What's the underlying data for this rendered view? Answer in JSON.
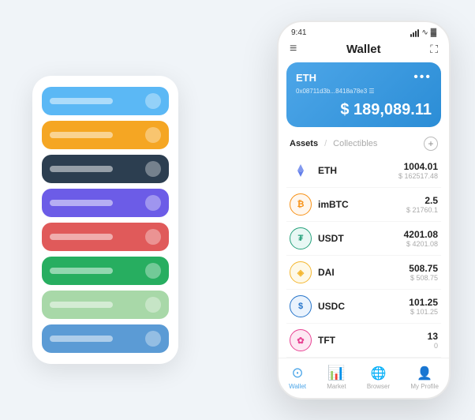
{
  "scene": {
    "card_stack": {
      "cards": [
        {
          "color": "card-blue"
        },
        {
          "color": "card-orange"
        },
        {
          "color": "card-dark"
        },
        {
          "color": "card-purple"
        },
        {
          "color": "card-red"
        },
        {
          "color": "card-green"
        },
        {
          "color": "card-light-green"
        },
        {
          "color": "card-cornflower"
        }
      ]
    },
    "phone": {
      "status_bar": {
        "time": "9:41",
        "signal": "●●●",
        "wifi": "WiFi",
        "battery": "🔋"
      },
      "header": {
        "menu_icon": "≡",
        "title": "Wallet",
        "scan_icon": "⛶"
      },
      "eth_card": {
        "name": "ETH",
        "dots": "•••",
        "address": "0x08711d3b...8418a78e3  ☰",
        "balance": "$ 189,089.11"
      },
      "assets_tabs": {
        "active": "Assets",
        "separator": "/",
        "inactive": "Collectibles",
        "add_icon": "+"
      },
      "assets": [
        {
          "symbol": "ETH",
          "icon": "♦",
          "icon_class": "icon-eth",
          "amount": "1004.01",
          "usd": "$ 162517.48"
        },
        {
          "symbol": "imBTC",
          "icon": "⊙",
          "icon_class": "icon-imbtc",
          "amount": "2.5",
          "usd": "$ 21760.1"
        },
        {
          "symbol": "USDT",
          "icon": "₮",
          "icon_class": "icon-usdt",
          "amount": "4201.08",
          "usd": "$ 4201.08"
        },
        {
          "symbol": "DAI",
          "icon": "◈",
          "icon_class": "icon-dai",
          "amount": "508.75",
          "usd": "$ 508.75"
        },
        {
          "symbol": "USDC",
          "icon": "$",
          "icon_class": "icon-usdc",
          "amount": "101.25",
          "usd": "$ 101.25"
        },
        {
          "symbol": "TFT",
          "icon": "❧",
          "icon_class": "icon-tft",
          "amount": "13",
          "usd": "0"
        }
      ],
      "bottom_nav": [
        {
          "label": "Wallet",
          "active": true,
          "icon": "⊙"
        },
        {
          "label": "Market",
          "active": false,
          "icon": "📈"
        },
        {
          "label": "Browser",
          "active": false,
          "icon": "👤"
        },
        {
          "label": "My Profile",
          "active": false,
          "icon": "👤"
        }
      ]
    }
  }
}
